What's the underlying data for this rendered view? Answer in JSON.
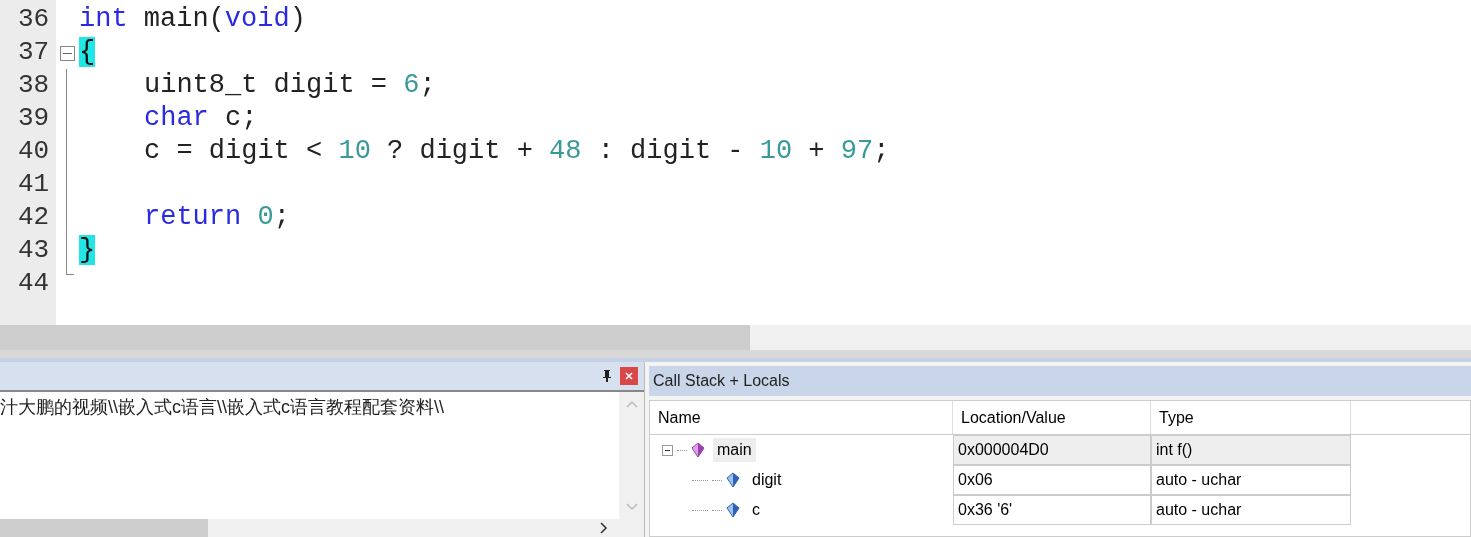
{
  "editor": {
    "lines": [
      {
        "number": "36",
        "kind": "code",
        "tokens": [
          {
            "kind": "keyword",
            "text": "int"
          },
          {
            "kind": "plain",
            "text": " main("
          },
          {
            "kind": "keyword",
            "text": "void"
          },
          {
            "kind": "plain",
            "text": ")"
          }
        ]
      },
      {
        "number": "37",
        "kind": "fold_start",
        "tokens": [
          {
            "kind": "brace",
            "text": "{"
          }
        ]
      },
      {
        "number": "38",
        "kind": "code",
        "indented": true,
        "tokens": [
          {
            "kind": "plain",
            "text": "uint8_t digit = "
          },
          {
            "kind": "number",
            "text": "6"
          },
          {
            "kind": "plain",
            "text": ";"
          }
        ]
      },
      {
        "number": "39",
        "kind": "code",
        "indented": true,
        "tokens": [
          {
            "kind": "keyword",
            "text": "char"
          },
          {
            "kind": "plain",
            "text": " c;"
          }
        ]
      },
      {
        "number": "40",
        "kind": "code",
        "indented": true,
        "tokens": [
          {
            "kind": "plain",
            "text": "c = digit < "
          },
          {
            "kind": "number",
            "text": "10"
          },
          {
            "kind": "plain",
            "text": " ? digit + "
          },
          {
            "kind": "number",
            "text": "48"
          },
          {
            "kind": "plain",
            "text": " : digit - "
          },
          {
            "kind": "number",
            "text": "10"
          },
          {
            "kind": "plain",
            "text": " + "
          },
          {
            "kind": "number",
            "text": "97"
          },
          {
            "kind": "plain",
            "text": ";"
          }
        ]
      },
      {
        "number": "41",
        "kind": "code"
      },
      {
        "number": "42",
        "kind": "code",
        "indented": true,
        "tokens": [
          {
            "kind": "keyword",
            "text": "return"
          },
          {
            "kind": "number",
            "text": " 0"
          },
          {
            "kind": "plain",
            "text": ";"
          }
        ]
      },
      {
        "number": "43",
        "kind": "code",
        "tokens": [
          {
            "kind": "brace",
            "text": "}"
          }
        ]
      },
      {
        "number": "44",
        "kind": "fold_end"
      }
    ]
  },
  "output_panel": {
    "text": "汁大鹏的视频\\\\嵌入式c语言\\\\嵌入式c语言教程配套资料\\\\"
  },
  "locals_panel": {
    "title": "Call Stack + Locals",
    "columns": [
      "Name",
      "Location/Value",
      "Type"
    ],
    "rows": [
      {
        "name": "main",
        "kind": "function",
        "value": "0x000004D0",
        "type": "int f()",
        "expanded": true,
        "children": [
          {
            "name": "digit",
            "kind": "variable",
            "value": "0x06",
            "type": "auto - uchar"
          },
          {
            "name": "c",
            "kind": "variable",
            "value": "0x36 '6'",
            "type": "auto - uchar"
          }
        ]
      }
    ]
  }
}
